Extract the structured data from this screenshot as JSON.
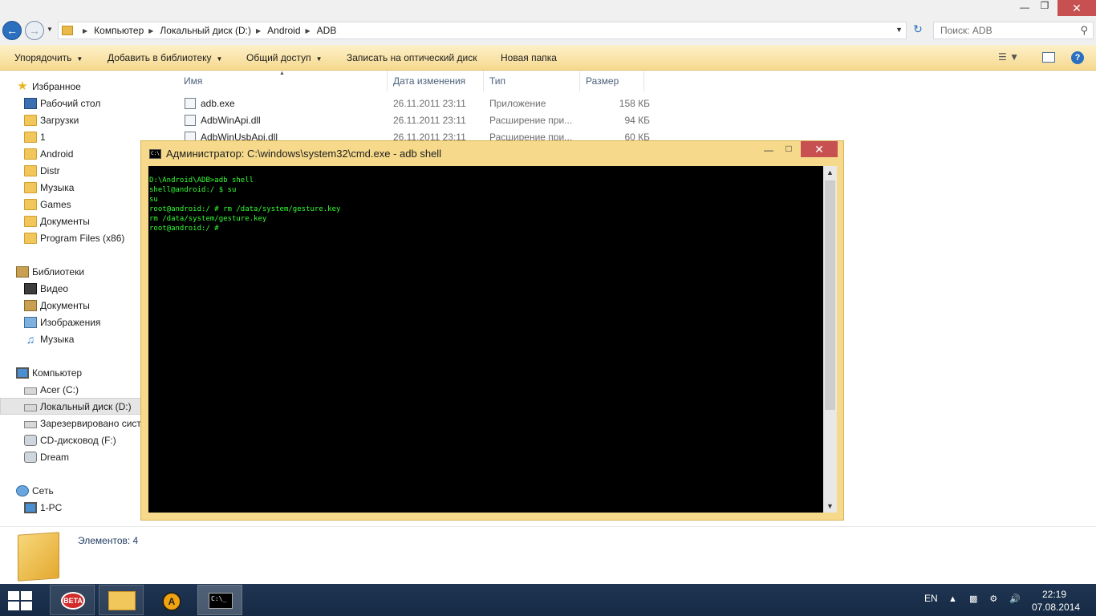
{
  "explorer": {
    "breadcrumbs": [
      "Компьютер",
      "Локальный диск (D:)",
      "Android",
      "ADB"
    ],
    "search_placeholder": "Поиск: ADB",
    "commands": [
      {
        "label": "Упорядочить",
        "has_menu": true
      },
      {
        "label": "Добавить в библиотеку",
        "has_menu": true
      },
      {
        "label": "Общий доступ",
        "has_menu": true
      },
      {
        "label": "Записать на оптический диск",
        "has_menu": false
      },
      {
        "label": "Новая папка",
        "has_menu": false
      }
    ],
    "columns": {
      "name": "Имя",
      "date": "Дата изменения",
      "type": "Тип",
      "size": "Размер"
    },
    "files": [
      {
        "name": "adb.exe",
        "date": "26.11.2011 23:11",
        "type": "Приложение",
        "size": "158 КБ"
      },
      {
        "name": "AdbWinApi.dll",
        "date": "26.11.2011 23:11",
        "type": "Расширение при...",
        "size": "94 КБ"
      },
      {
        "name": "AdbWinUsbApi.dll",
        "date": "26.11.2011 23:11",
        "type": "Расширение при...",
        "size": "60 КБ"
      }
    ],
    "items_count": "Элементов: 4"
  },
  "nav": {
    "favorites": {
      "label": "Избранное",
      "items": [
        "Рабочий стол",
        "Загрузки",
        "1",
        "Android",
        "Distr",
        "Музыка",
        "Games",
        "Документы",
        "Program Files (x86)"
      ]
    },
    "libraries": {
      "label": "Библиотеки",
      "items": [
        "Видео",
        "Документы",
        "Изображения",
        "Музыка"
      ]
    },
    "computer": {
      "label": "Компьютер",
      "items": [
        "Acer (C:)",
        "Локальный диск (D:)",
        "Зарезервировано сист",
        "CD-дисковод (F:)",
        "Dream"
      ],
      "selected": "Локальный диск (D:)"
    },
    "network": {
      "label": "Сеть",
      "items": [
        "1-PC"
      ]
    }
  },
  "cmd": {
    "title": "Администратор: C:\\windows\\system32\\cmd.exe - adb  shell",
    "icon_text": "C:\\",
    "lines": [
      "D:\\Android\\ADB>adb shell",
      "shell@android:/ $ su",
      "su",
      "root@android:/ # rm /data/system/gesture.key",
      "rm /data/system/gesture.key",
      "root@android:/ #"
    ],
    "text_color": "#33ff33"
  },
  "taskbar": {
    "beta_label": "BETA",
    "cmd_icon_text": "C:\\_",
    "language": "EN",
    "time": "22:19",
    "date": "07.08.2014"
  },
  "colors": {
    "command_bar": "#f6d98e",
    "close_button": "#c75050",
    "taskbar": "#1f3552"
  }
}
